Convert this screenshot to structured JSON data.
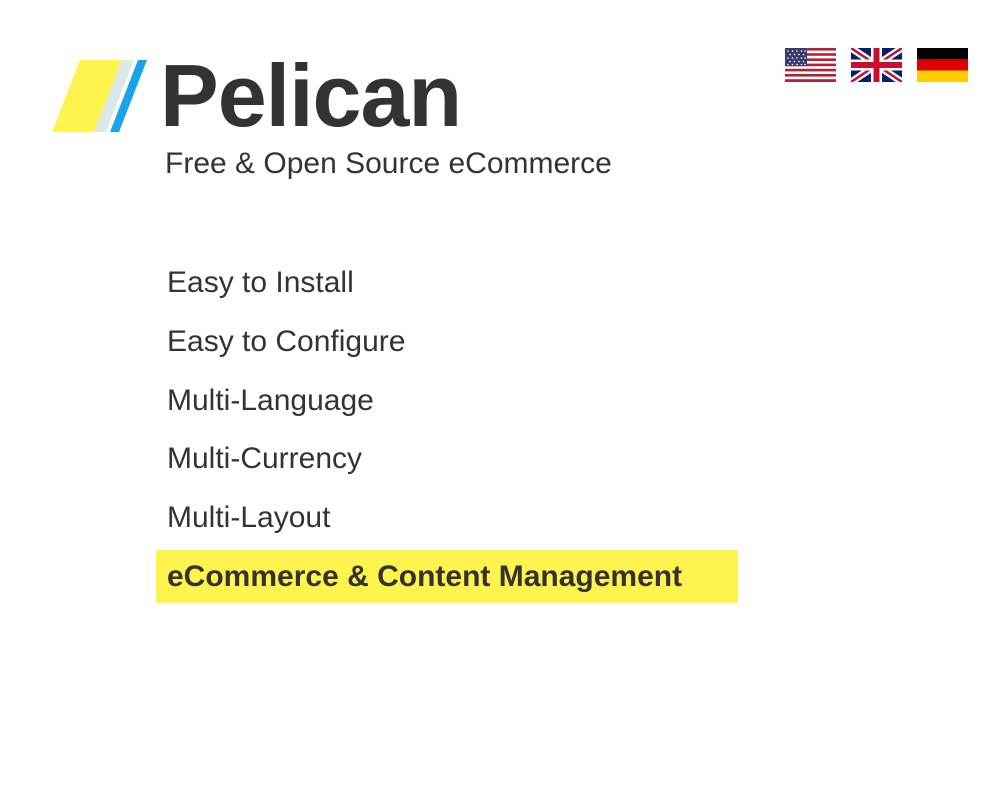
{
  "brand": {
    "name": "Pelican",
    "tagline": "Free & Open Source eCommerce",
    "logo_icon": "pelican-logo-stripes-icon",
    "colors": {
      "yellow": "#fff34d",
      "light": "#dce9ea",
      "blue": "#1aa3e8"
    }
  },
  "languages": [
    {
      "icon": "us-flag-icon"
    },
    {
      "icon": "uk-flag-icon"
    },
    {
      "icon": "germany-flag-icon"
    }
  ],
  "features": [
    {
      "label": "Easy to Install"
    },
    {
      "label": "Easy to Configure"
    },
    {
      "label": "Multi-Language"
    },
    {
      "label": "Multi-Currency"
    },
    {
      "label": "Multi-Layout"
    },
    {
      "label": "eCommerce & Content Management",
      "highlighted": true
    }
  ],
  "colors": {
    "text": "#333333",
    "highlight": "#fff34d"
  }
}
